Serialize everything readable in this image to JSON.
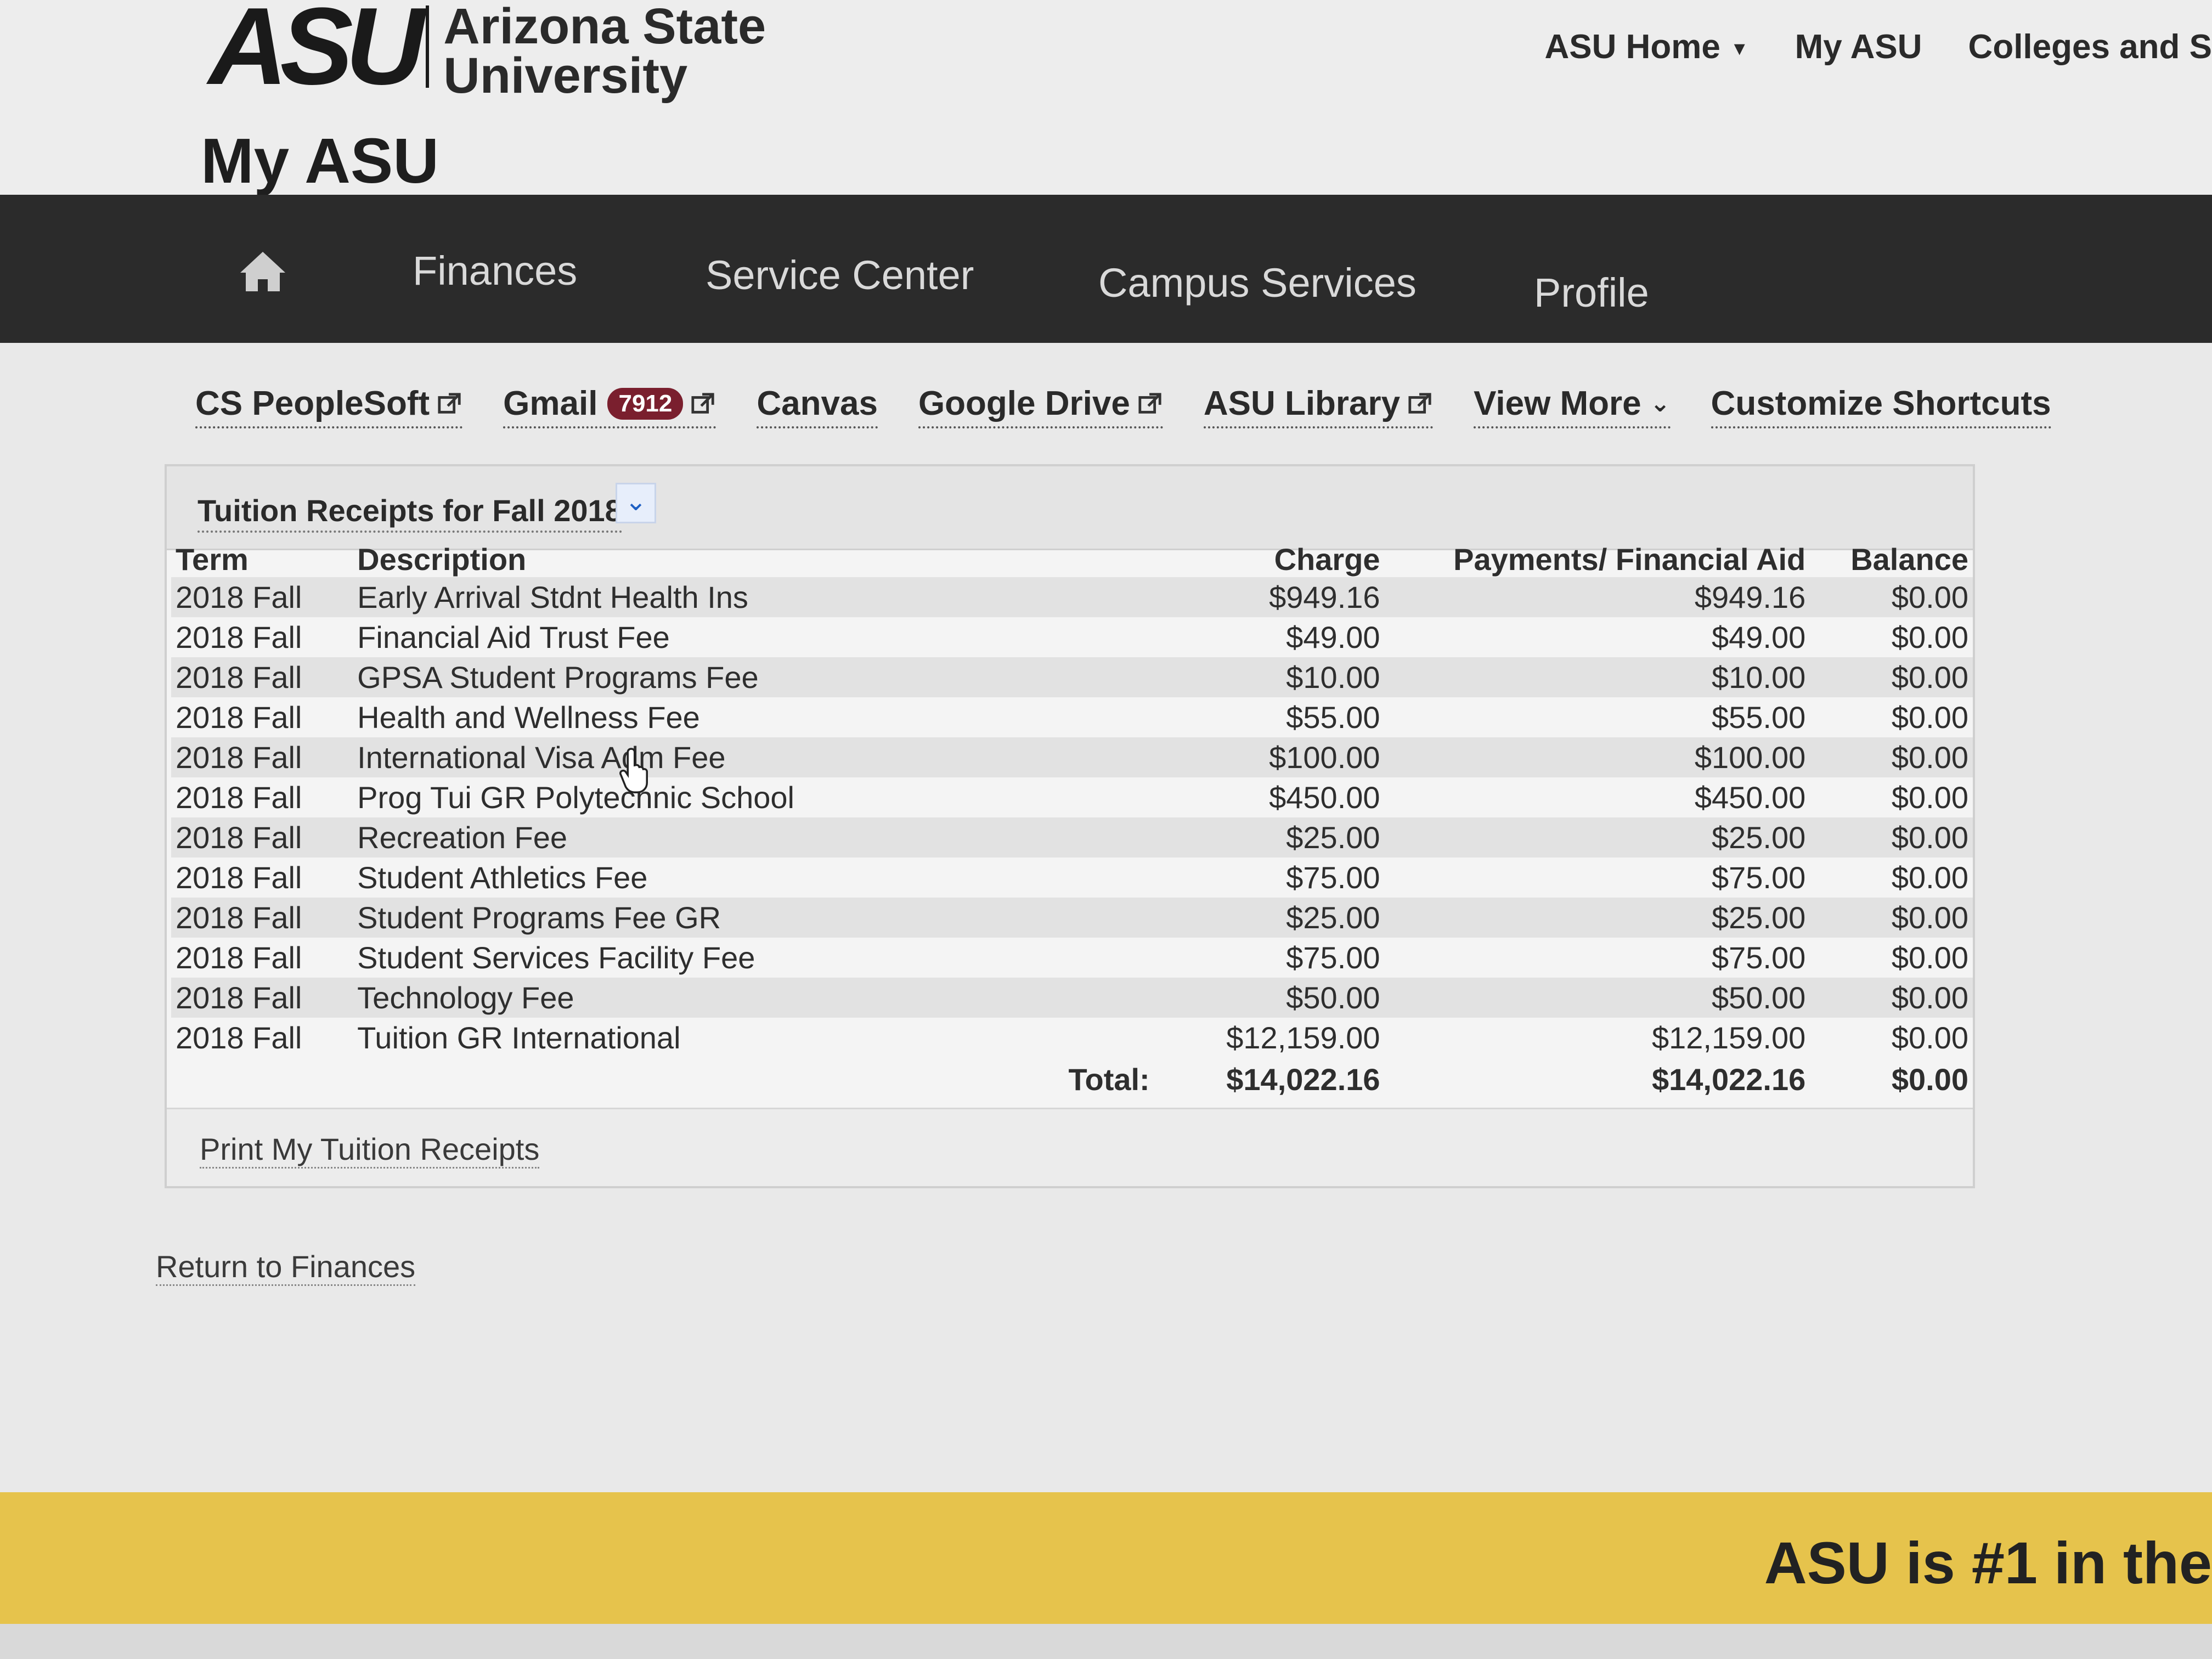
{
  "logo": {
    "mark": "ASU",
    "name_line1": "Arizona State",
    "name_line2": "University"
  },
  "header": {
    "title": "My ASU"
  },
  "util_links": [
    {
      "label": "ASU Home",
      "has_dropdown": true
    },
    {
      "label": "My ASU"
    },
    {
      "label": "Colleges and S"
    }
  ],
  "nav": {
    "home_icon": "home-icon",
    "items": [
      "Finances",
      "Service Center",
      "Campus Services",
      "Profile"
    ]
  },
  "shortcuts": {
    "items": [
      {
        "label": "CS PeopleSoft",
        "external": true
      },
      {
        "label": "Gmail",
        "badge": "7912",
        "external": true
      },
      {
        "label": "Canvas"
      },
      {
        "label": "Google Drive",
        "external": true
      },
      {
        "label": "ASU Library",
        "external": true
      },
      {
        "label": "View More",
        "dropdown": true
      },
      {
        "label": "Customize Shortcuts"
      }
    ]
  },
  "receipts": {
    "title": "Tuition Receipts for Fall 2018",
    "columns": {
      "term": "Term",
      "description": "Description",
      "charge": "Charge",
      "payments": "Payments/ Financial Aid",
      "balance": "Balance"
    },
    "rows": [
      {
        "term": "2018 Fall",
        "description": "Early Arrival Stdnt Health Ins",
        "charge": "$949.16",
        "payments": "$949.16",
        "balance": "$0.00"
      },
      {
        "term": "2018 Fall",
        "description": "Financial Aid Trust Fee",
        "charge": "$49.00",
        "payments": "$49.00",
        "balance": "$0.00"
      },
      {
        "term": "2018 Fall",
        "description": "GPSA Student Programs Fee",
        "charge": "$10.00",
        "payments": "$10.00",
        "balance": "$0.00"
      },
      {
        "term": "2018 Fall",
        "description": "Health and Wellness Fee",
        "charge": "$55.00",
        "payments": "$55.00",
        "balance": "$0.00"
      },
      {
        "term": "2018 Fall",
        "description": "International Visa Adm Fee",
        "charge": "$100.00",
        "payments": "$100.00",
        "balance": "$0.00"
      },
      {
        "term": "2018 Fall",
        "description": "Prog Tui GR Polytechnic School",
        "charge": "$450.00",
        "payments": "$450.00",
        "balance": "$0.00"
      },
      {
        "term": "2018 Fall",
        "description": "Recreation Fee",
        "charge": "$25.00",
        "payments": "$25.00",
        "balance": "$0.00"
      },
      {
        "term": "2018 Fall",
        "description": "Student Athletics Fee",
        "charge": "$75.00",
        "payments": "$75.00",
        "balance": "$0.00"
      },
      {
        "term": "2018 Fall",
        "description": "Student Programs Fee GR",
        "charge": "$25.00",
        "payments": "$25.00",
        "balance": "$0.00"
      },
      {
        "term": "2018 Fall",
        "description": "Student Services Facility Fee",
        "charge": "$75.00",
        "payments": "$75.00",
        "balance": "$0.00"
      },
      {
        "term": "2018 Fall",
        "description": "Technology Fee",
        "charge": "$50.00",
        "payments": "$50.00",
        "balance": "$0.00"
      },
      {
        "term": "2018 Fall",
        "description": "Tuition GR International",
        "charge": "$12,159.00",
        "payments": "$12,159.00",
        "balance": "$0.00"
      }
    ],
    "total": {
      "label": "Total:",
      "charge": "$14,022.16",
      "payments": "$14,022.16",
      "balance": "$0.00"
    },
    "print_label": "Print My Tuition Receipts"
  },
  "return_label": "Return to Finances",
  "banner": {
    "text": "ASU is #1 in the"
  },
  "colors": {
    "nav_bg": "#2b2b2b",
    "banner_gold": "#e6c34c",
    "badge_maroon": "#7a1f2e"
  }
}
